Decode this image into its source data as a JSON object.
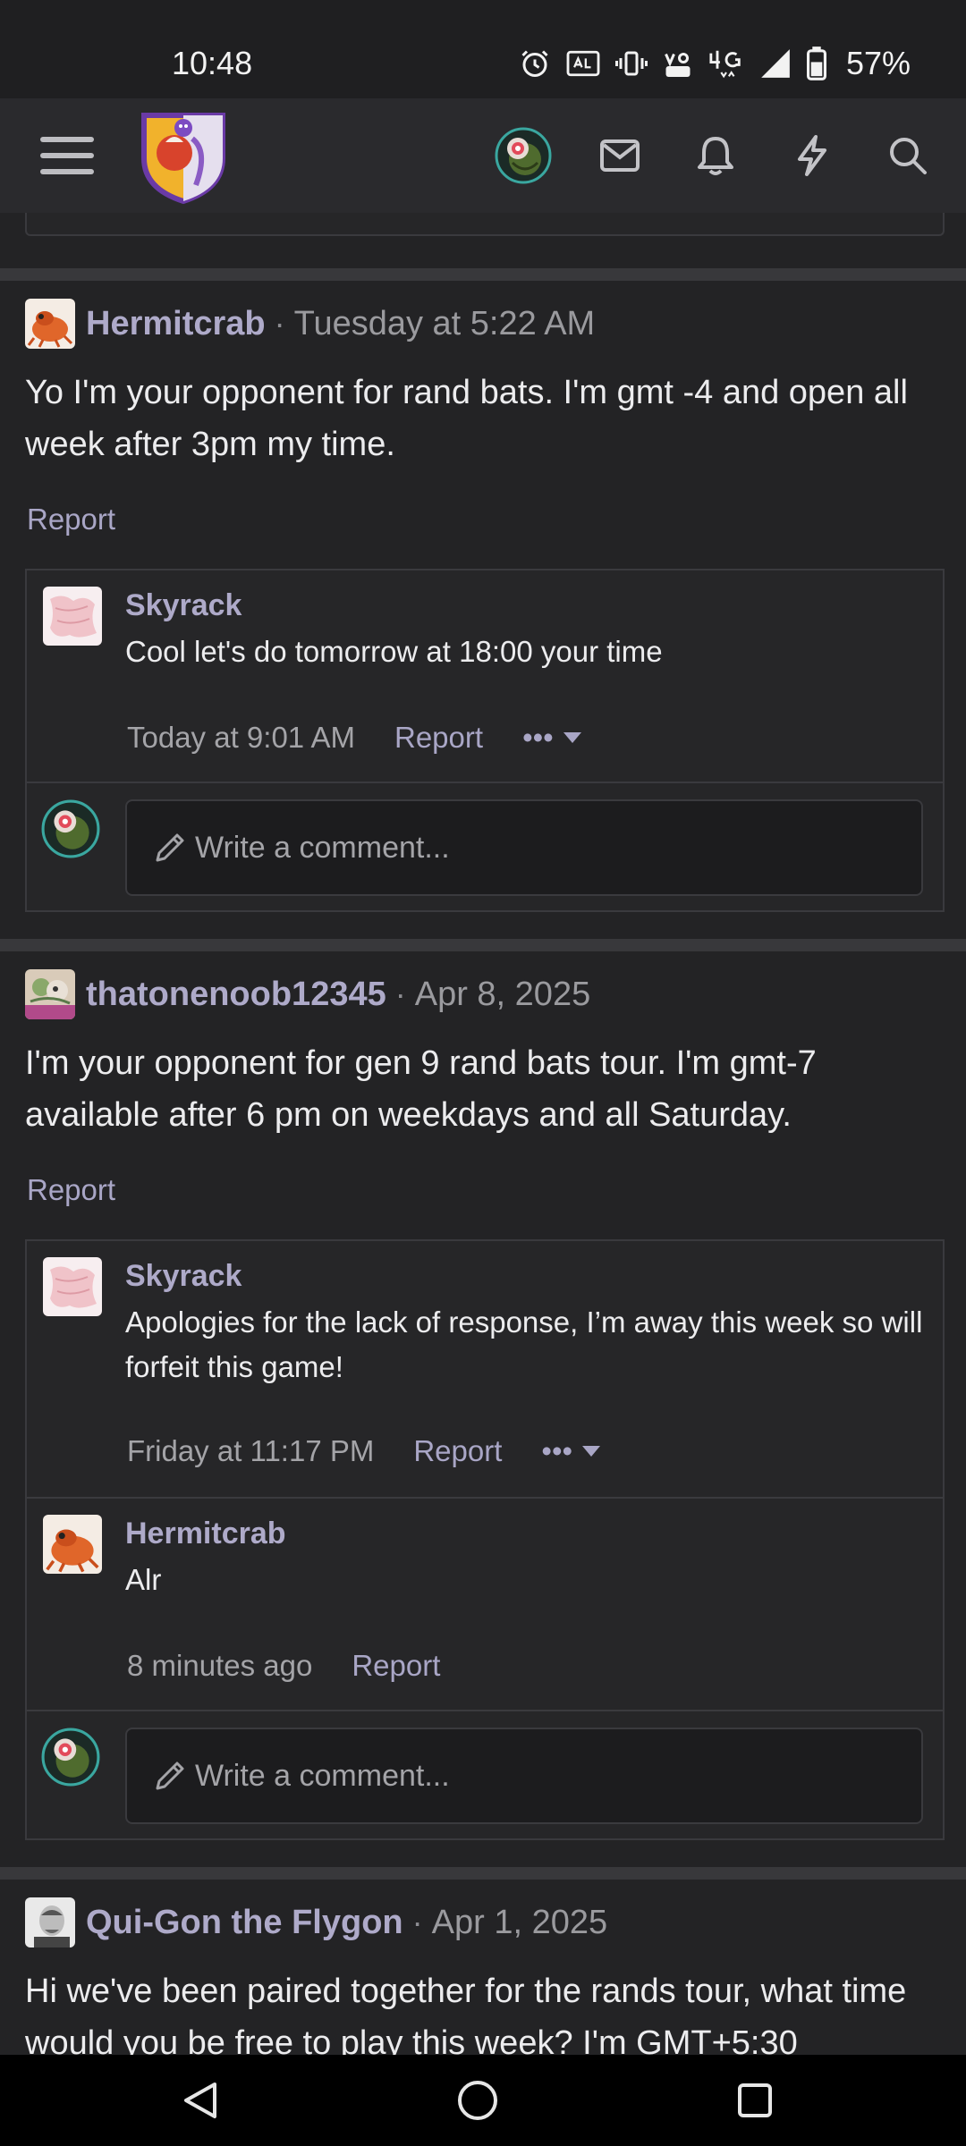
{
  "status_bar": {
    "time": "10:48",
    "battery_percent": "57%",
    "icons": [
      "alarm-icon",
      "auto-hz-icon",
      "vibrate-icon",
      "volte-icon",
      "4g-icon",
      "signal-icon",
      "battery-icon"
    ]
  },
  "nav": {
    "icons": [
      "hamburger-menu-icon",
      "site-logo",
      "user-avatar",
      "mail-icon",
      "bell-icon",
      "lightning-icon",
      "search-icon"
    ]
  },
  "posts": [
    {
      "author": "Hermitcrab",
      "date": "Tuesday at 5:22 AM",
      "body": "Yo I'm your opponent for rand bats. I'm gmt -4 and open all week after 3pm my time.",
      "report": "Report",
      "comments": [
        {
          "author": "Skyrack",
          "text": "Cool let's do tomorrow at 18:00 your time",
          "time": "Today at 9:01 AM",
          "report": "Report",
          "more": "•••"
        }
      ],
      "write_placeholder": "Write a comment..."
    },
    {
      "author": "thatonenoob12345",
      "date": "Apr 8, 2025",
      "body": "I'm your opponent for gen 9 rand bats tour. I'm gmt-7 available after 6 pm on weekdays and all Saturday.",
      "report": "Report",
      "comments": [
        {
          "author": "Skyrack",
          "text": "Apologies for the lack of response, I’m away this week so will forfeit this game!",
          "time": "Friday at 11:17 PM",
          "report": "Report",
          "more": "•••"
        },
        {
          "author": "Hermitcrab",
          "text": "Alr",
          "time": "8 minutes ago",
          "report": "Report"
        }
      ],
      "write_placeholder": "Write a comment..."
    },
    {
      "author": "Qui-Gon the Flygon",
      "date": "Apr 1, 2025",
      "body": "Hi we've been paired together for the rands tour, what time would you be free to play this week? I'm GMT+5:30"
    }
  ],
  "system_nav": {
    "icons": [
      "back-icon",
      "home-icon",
      "recents-icon"
    ]
  },
  "colors": {
    "background": "#232325",
    "username": "#aeaac9",
    "link": "#a9a6c6",
    "border": "#3a3a3e"
  }
}
